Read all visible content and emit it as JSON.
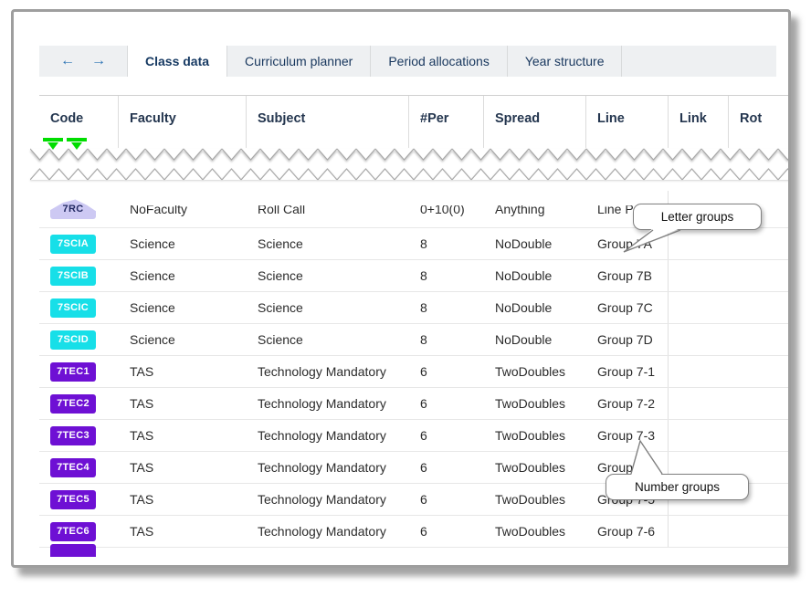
{
  "tabbar": {
    "back": "←",
    "forward": "→",
    "tabs": [
      {
        "label": "Class data",
        "active": true
      },
      {
        "label": "Curriculum planner",
        "active": false
      },
      {
        "label": "Period allocations",
        "active": false
      },
      {
        "label": "Year structure",
        "active": false
      }
    ]
  },
  "table": {
    "columns": [
      {
        "label": "Code"
      },
      {
        "label": "Faculty"
      },
      {
        "label": "Subject"
      },
      {
        "label": "#Per"
      },
      {
        "label": "Spread"
      },
      {
        "label": "Line"
      },
      {
        "label": "Link"
      },
      {
        "label": "Rot"
      }
    ],
    "torn_row": {
      "code": "7RC",
      "badge_color": "#cdc9f3",
      "faculty": "NoFaculty",
      "subject": "Roll Call",
      "per": "0+10(0)",
      "spread": "Anything",
      "line": "Line P"
    },
    "rows": [
      {
        "code": "7SCIA",
        "badge_color": "#17dfe8",
        "faculty": "Science",
        "subject": "Science",
        "per": "8",
        "spread": "NoDouble",
        "line": "Group 7A"
      },
      {
        "code": "7SCIB",
        "badge_color": "#17dfe8",
        "faculty": "Science",
        "subject": "Science",
        "per": "8",
        "spread": "NoDouble",
        "line": "Group 7B"
      },
      {
        "code": "7SCIC",
        "badge_color": "#17dfe8",
        "faculty": "Science",
        "subject": "Science",
        "per": "8",
        "spread": "NoDouble",
        "line": "Group 7C"
      },
      {
        "code": "7SCID",
        "badge_color": "#17dfe8",
        "faculty": "Science",
        "subject": "Science",
        "per": "8",
        "spread": "NoDouble",
        "line": "Group 7D"
      },
      {
        "code": "7TEC1",
        "badge_color": "#6e10d4",
        "faculty": "TAS",
        "subject": "Technology Mandatory",
        "per": "6",
        "spread": "TwoDoubles",
        "line": "Group 7-1"
      },
      {
        "code": "7TEC2",
        "badge_color": "#6e10d4",
        "faculty": "TAS",
        "subject": "Technology Mandatory",
        "per": "6",
        "spread": "TwoDoubles",
        "line": "Group 7-2"
      },
      {
        "code": "7TEC3",
        "badge_color": "#6e10d4",
        "faculty": "TAS",
        "subject": "Technology Mandatory",
        "per": "6",
        "spread": "TwoDoubles",
        "line": "Group 7-3"
      },
      {
        "code": "7TEC4",
        "badge_color": "#6e10d4",
        "faculty": "TAS",
        "subject": "Technology Mandatory",
        "per": "6",
        "spread": "TwoDoubles",
        "line": "Group 7-4"
      },
      {
        "code": "7TEC5",
        "badge_color": "#6e10d4",
        "faculty": "TAS",
        "subject": "Technology Mandatory",
        "per": "6",
        "spread": "TwoDoubles",
        "line": "Group 7-5"
      },
      {
        "code": "7TEC6",
        "badge_color": "#6e10d4",
        "faculty": "TAS",
        "subject": "Technology Mandatory",
        "per": "6",
        "spread": "TwoDoubles",
        "line": "Group 7-6"
      }
    ]
  },
  "callouts": {
    "letter_groups": "Letter groups",
    "number_groups": "Number groups"
  },
  "colors": {
    "science_badge": "#17dfe8",
    "tas_badge": "#6e10d4",
    "torn_badge": "#cdc9f3",
    "selection_green": "#00dd00",
    "tab_accent": "#2e74b5",
    "header_text": "#24364f"
  }
}
